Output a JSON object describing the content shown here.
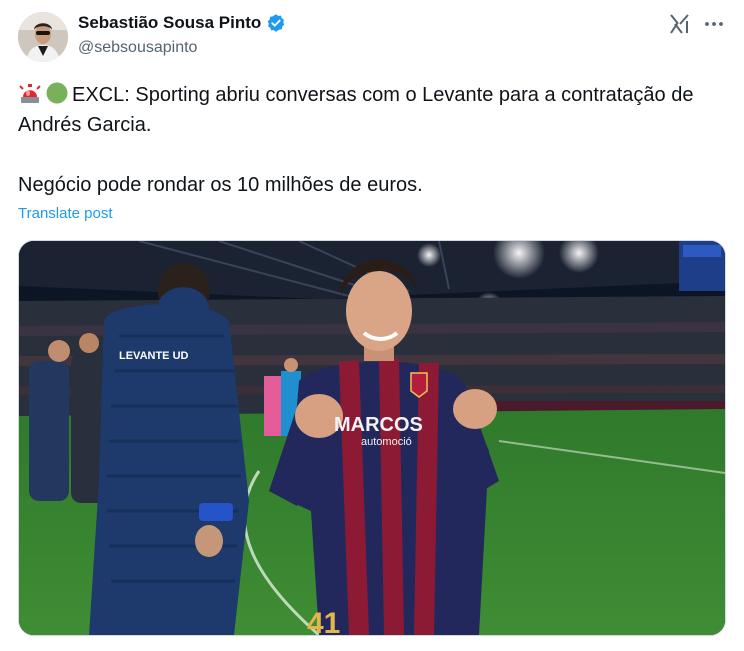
{
  "author": {
    "display_name": "Sebastião Sousa Pinto",
    "handle": "@sebsousapinto",
    "verified": true,
    "avatar_icon": "avatar-photo"
  },
  "actions": {
    "grok_icon": "grok-icon",
    "more_icon": "more-icon"
  },
  "tweet": {
    "line1_emojis": [
      "police-light-emoji",
      "green-circle-emoji"
    ],
    "paragraph1": "EXCL: Sporting abriu conversas com o Levante para a contratação de Andrés Garcia.",
    "paragraph2": "Negócio pode rondar os 10 milhões de euros.",
    "translate_label": "Translate post"
  },
  "media": {
    "type": "photo",
    "jacket_text": "LEVANTE UD",
    "shirt_sponsor": "MARCOS",
    "shirt_sponsor_sub": "automoció",
    "shirt_number": "41"
  },
  "colors": {
    "link": "#1d9bf0",
    "verified": "#1d9bf0",
    "secondary_text": "#536471",
    "primary_text": "#0f1419"
  }
}
